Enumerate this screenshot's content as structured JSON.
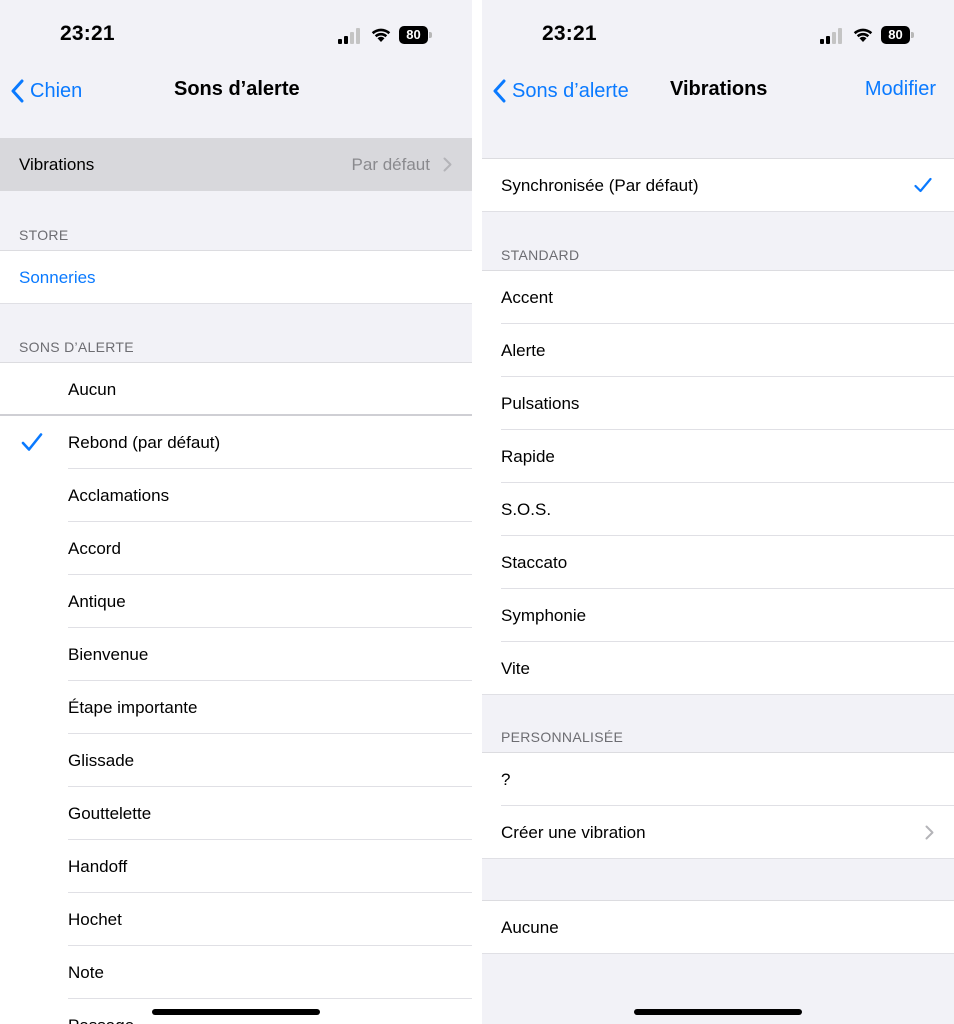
{
  "status": {
    "time": "23:21",
    "battery": "80"
  },
  "left": {
    "nav": {
      "back_label": "Chien",
      "title": "Sons d’alerte"
    },
    "vibrations": {
      "label": "Vibrations",
      "value": "Par défaut"
    },
    "store_header": "STORE",
    "store_link": "Sonneries",
    "sounds_header": "SONS D’ALERTE",
    "sounds": [
      {
        "label": "Aucun"
      },
      {
        "label": "Rebond (par défaut)",
        "selected": true
      },
      {
        "label": "Acclamations"
      },
      {
        "label": "Accord"
      },
      {
        "label": "Antique"
      },
      {
        "label": "Bienvenue"
      },
      {
        "label": "Étape importante"
      },
      {
        "label": "Glissade"
      },
      {
        "label": "Gouttelette"
      },
      {
        "label": "Handoff"
      },
      {
        "label": "Hochet"
      },
      {
        "label": "Note"
      },
      {
        "label": "Passage"
      }
    ]
  },
  "right": {
    "nav": {
      "back_label": "Sons d’alerte",
      "title": "Vibrations",
      "action_label": "Modifier"
    },
    "synced": {
      "label": "Synchronisée (Par défaut)",
      "selected": true
    },
    "standard_header": "STANDARD",
    "standard": [
      "Accent",
      "Alerte",
      "Pulsations",
      "Rapide",
      "S.O.S.",
      "Staccato",
      "Symphonie",
      "Vite"
    ],
    "custom_header": "PERSONNALISÉE",
    "custom": [
      "?",
      "Créer une vibration"
    ],
    "none_label": "Aucune"
  },
  "colors": {
    "accent": "#0a7aff",
    "background": "#f2f2f7",
    "selected_row": "#d8d8dc"
  },
  "icons": [
    "signal-icon",
    "wifi-icon",
    "battery-icon",
    "chevron-left-icon",
    "chevron-right-icon",
    "checkmark-icon"
  ]
}
